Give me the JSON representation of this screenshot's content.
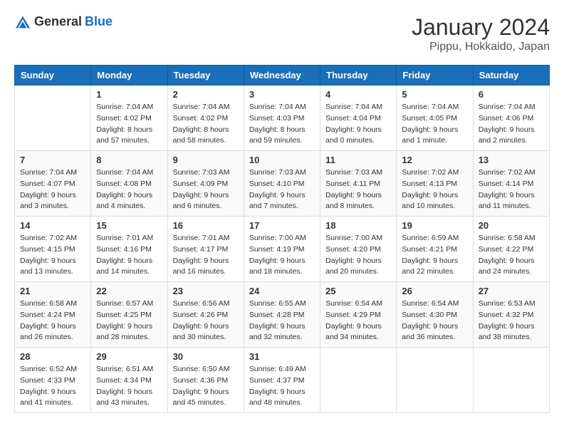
{
  "app": {
    "logo_general": "General",
    "logo_blue": "Blue"
  },
  "header": {
    "month": "January 2024",
    "location": "Pippu, Hokkaido, Japan"
  },
  "days_of_week": [
    "Sunday",
    "Monday",
    "Tuesday",
    "Wednesday",
    "Thursday",
    "Friday",
    "Saturday"
  ],
  "weeks": [
    [
      {
        "day": "",
        "sunrise": "",
        "sunset": "",
        "daylight": ""
      },
      {
        "day": "1",
        "sunrise": "Sunrise: 7:04 AM",
        "sunset": "Sunset: 4:02 PM",
        "daylight": "Daylight: 8 hours and 57 minutes."
      },
      {
        "day": "2",
        "sunrise": "Sunrise: 7:04 AM",
        "sunset": "Sunset: 4:02 PM",
        "daylight": "Daylight: 8 hours and 58 minutes."
      },
      {
        "day": "3",
        "sunrise": "Sunrise: 7:04 AM",
        "sunset": "Sunset: 4:03 PM",
        "daylight": "Daylight: 8 hours and 59 minutes."
      },
      {
        "day": "4",
        "sunrise": "Sunrise: 7:04 AM",
        "sunset": "Sunset: 4:04 PM",
        "daylight": "Daylight: 9 hours and 0 minutes."
      },
      {
        "day": "5",
        "sunrise": "Sunrise: 7:04 AM",
        "sunset": "Sunset: 4:05 PM",
        "daylight": "Daylight: 9 hours and 1 minute."
      },
      {
        "day": "6",
        "sunrise": "Sunrise: 7:04 AM",
        "sunset": "Sunset: 4:06 PM",
        "daylight": "Daylight: 9 hours and 2 minutes."
      }
    ],
    [
      {
        "day": "7",
        "sunrise": "Sunrise: 7:04 AM",
        "sunset": "Sunset: 4:07 PM",
        "daylight": "Daylight: 9 hours and 3 minutes."
      },
      {
        "day": "8",
        "sunrise": "Sunrise: 7:04 AM",
        "sunset": "Sunset: 4:08 PM",
        "daylight": "Daylight: 9 hours and 4 minutes."
      },
      {
        "day": "9",
        "sunrise": "Sunrise: 7:03 AM",
        "sunset": "Sunset: 4:09 PM",
        "daylight": "Daylight: 9 hours and 6 minutes."
      },
      {
        "day": "10",
        "sunrise": "Sunrise: 7:03 AM",
        "sunset": "Sunset: 4:10 PM",
        "daylight": "Daylight: 9 hours and 7 minutes."
      },
      {
        "day": "11",
        "sunrise": "Sunrise: 7:03 AM",
        "sunset": "Sunset: 4:11 PM",
        "daylight": "Daylight: 9 hours and 8 minutes."
      },
      {
        "day": "12",
        "sunrise": "Sunrise: 7:02 AM",
        "sunset": "Sunset: 4:13 PM",
        "daylight": "Daylight: 9 hours and 10 minutes."
      },
      {
        "day": "13",
        "sunrise": "Sunrise: 7:02 AM",
        "sunset": "Sunset: 4:14 PM",
        "daylight": "Daylight: 9 hours and 11 minutes."
      }
    ],
    [
      {
        "day": "14",
        "sunrise": "Sunrise: 7:02 AM",
        "sunset": "Sunset: 4:15 PM",
        "daylight": "Daylight: 9 hours and 13 minutes."
      },
      {
        "day": "15",
        "sunrise": "Sunrise: 7:01 AM",
        "sunset": "Sunset: 4:16 PM",
        "daylight": "Daylight: 9 hours and 14 minutes."
      },
      {
        "day": "16",
        "sunrise": "Sunrise: 7:01 AM",
        "sunset": "Sunset: 4:17 PM",
        "daylight": "Daylight: 9 hours and 16 minutes."
      },
      {
        "day": "17",
        "sunrise": "Sunrise: 7:00 AM",
        "sunset": "Sunset: 4:19 PM",
        "daylight": "Daylight: 9 hours and 18 minutes."
      },
      {
        "day": "18",
        "sunrise": "Sunrise: 7:00 AM",
        "sunset": "Sunset: 4:20 PM",
        "daylight": "Daylight: 9 hours and 20 minutes."
      },
      {
        "day": "19",
        "sunrise": "Sunrise: 6:59 AM",
        "sunset": "Sunset: 4:21 PM",
        "daylight": "Daylight: 9 hours and 22 minutes."
      },
      {
        "day": "20",
        "sunrise": "Sunrise: 6:58 AM",
        "sunset": "Sunset: 4:22 PM",
        "daylight": "Daylight: 9 hours and 24 minutes."
      }
    ],
    [
      {
        "day": "21",
        "sunrise": "Sunrise: 6:58 AM",
        "sunset": "Sunset: 4:24 PM",
        "daylight": "Daylight: 9 hours and 26 minutes."
      },
      {
        "day": "22",
        "sunrise": "Sunrise: 6:57 AM",
        "sunset": "Sunset: 4:25 PM",
        "daylight": "Daylight: 9 hours and 28 minutes."
      },
      {
        "day": "23",
        "sunrise": "Sunrise: 6:56 AM",
        "sunset": "Sunset: 4:26 PM",
        "daylight": "Daylight: 9 hours and 30 minutes."
      },
      {
        "day": "24",
        "sunrise": "Sunrise: 6:55 AM",
        "sunset": "Sunset: 4:28 PM",
        "daylight": "Daylight: 9 hours and 32 minutes."
      },
      {
        "day": "25",
        "sunrise": "Sunrise: 6:54 AM",
        "sunset": "Sunset: 4:29 PM",
        "daylight": "Daylight: 9 hours and 34 minutes."
      },
      {
        "day": "26",
        "sunrise": "Sunrise: 6:54 AM",
        "sunset": "Sunset: 4:30 PM",
        "daylight": "Daylight: 9 hours and 36 minutes."
      },
      {
        "day": "27",
        "sunrise": "Sunrise: 6:53 AM",
        "sunset": "Sunset: 4:32 PM",
        "daylight": "Daylight: 9 hours and 38 minutes."
      }
    ],
    [
      {
        "day": "28",
        "sunrise": "Sunrise: 6:52 AM",
        "sunset": "Sunset: 4:33 PM",
        "daylight": "Daylight: 9 hours and 41 minutes."
      },
      {
        "day": "29",
        "sunrise": "Sunrise: 6:51 AM",
        "sunset": "Sunset: 4:34 PM",
        "daylight": "Daylight: 9 hours and 43 minutes."
      },
      {
        "day": "30",
        "sunrise": "Sunrise: 6:50 AM",
        "sunset": "Sunset: 4:36 PM",
        "daylight": "Daylight: 9 hours and 45 minutes."
      },
      {
        "day": "31",
        "sunrise": "Sunrise: 6:49 AM",
        "sunset": "Sunset: 4:37 PM",
        "daylight": "Daylight: 9 hours and 48 minutes."
      },
      {
        "day": "",
        "sunrise": "",
        "sunset": "",
        "daylight": ""
      },
      {
        "day": "",
        "sunrise": "",
        "sunset": "",
        "daylight": ""
      },
      {
        "day": "",
        "sunrise": "",
        "sunset": "",
        "daylight": ""
      }
    ]
  ]
}
